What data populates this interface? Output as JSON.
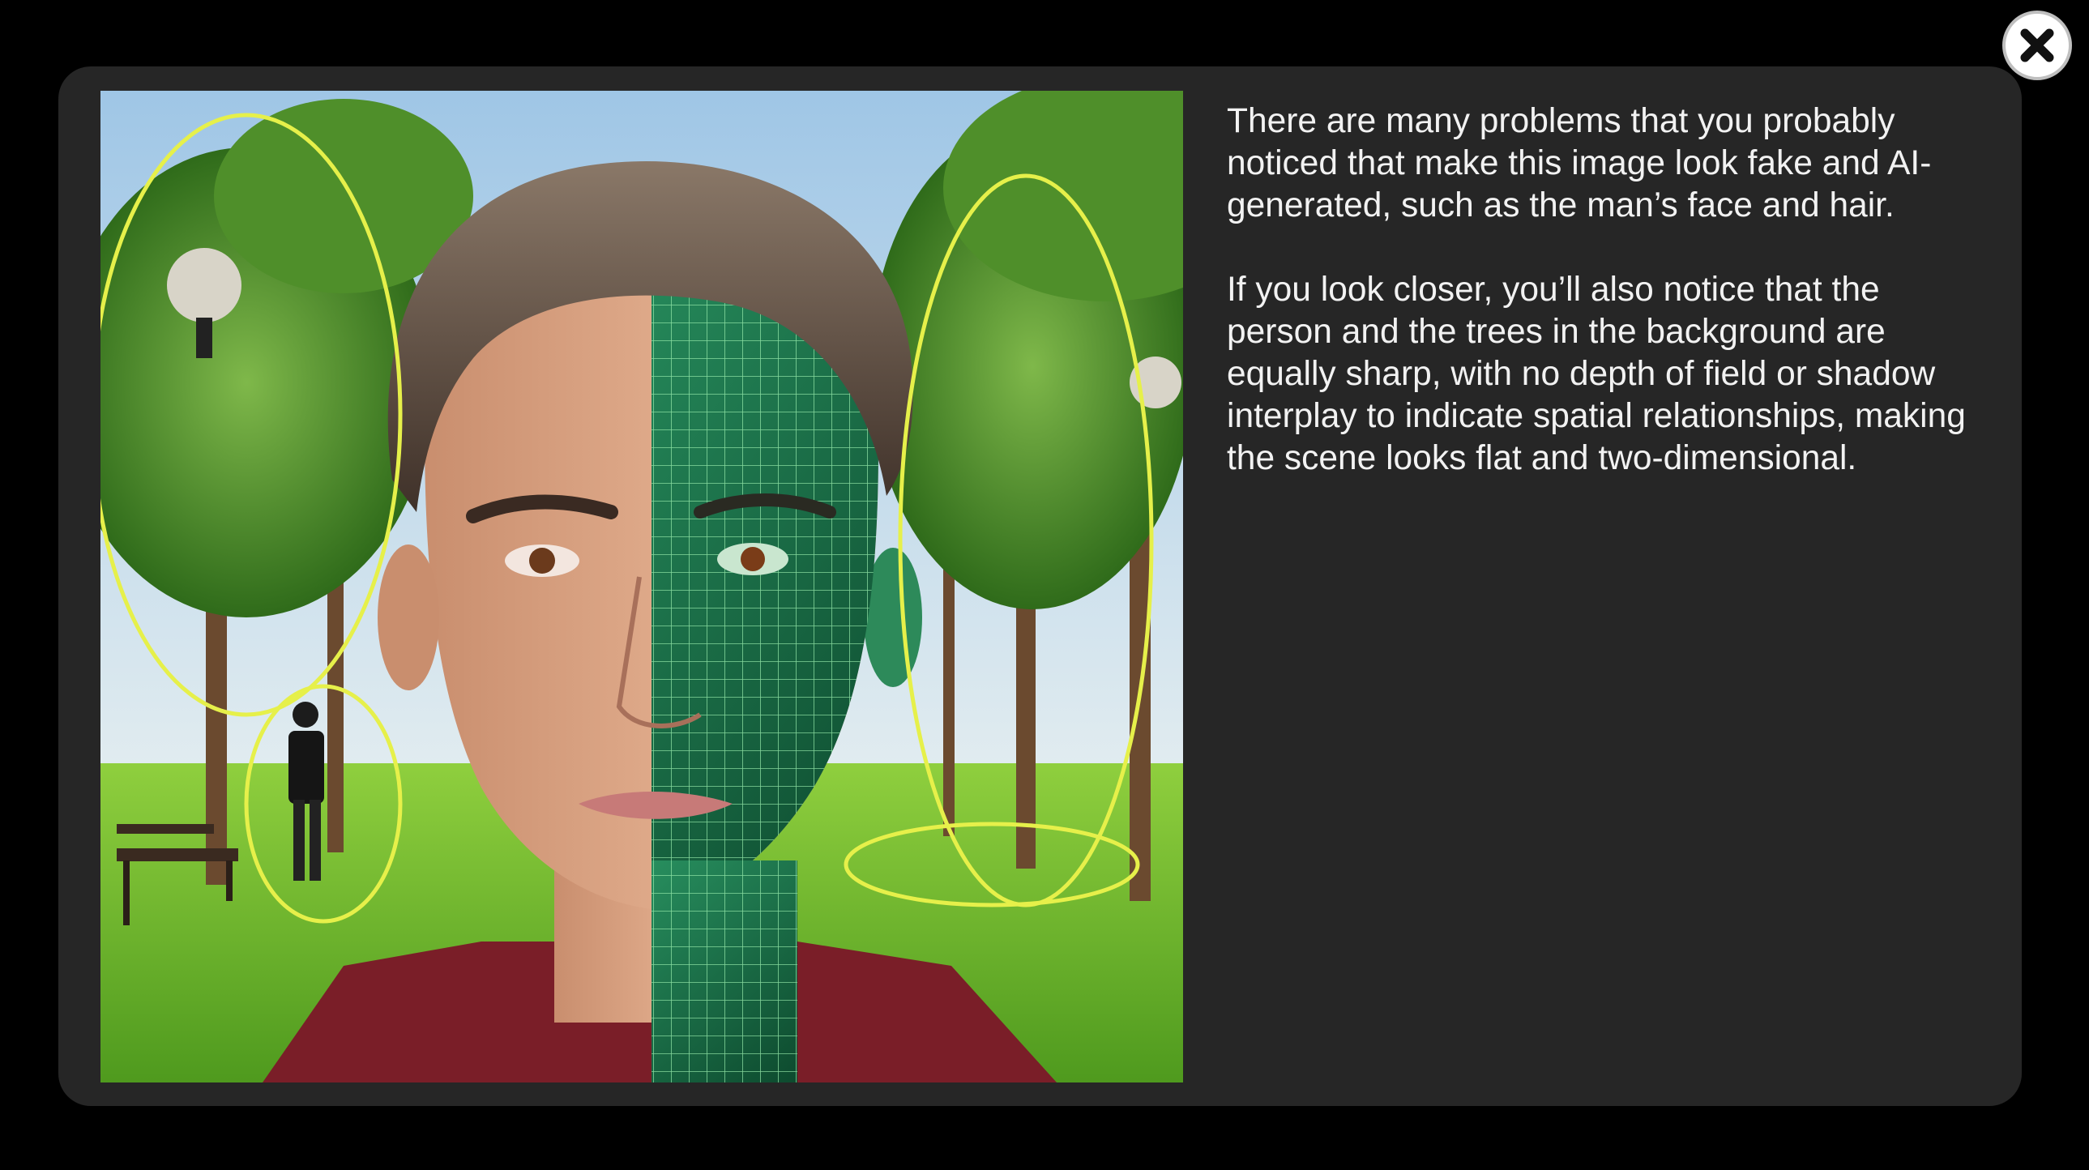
{
  "modal": {
    "image": {
      "description_icon": "ai-face-wireframe-image",
      "highlight_color": "#e6f04a"
    },
    "paragraphs": [
      "There are many problems that you probably noticed that make this image look fake and AI-generated, such as the man’s face and hair.",
      "If you look closer, you’ll also notice that the person and the trees in the background are equally sharp, with no depth of field or shadow interplay to indicate spatial relationships, making the scene looks flat and two-dimensional."
    ]
  },
  "close_button": {
    "icon": "close-icon"
  },
  "colors": {
    "background": "#000000",
    "modal": "#262626",
    "text": "#f2f2f2"
  }
}
